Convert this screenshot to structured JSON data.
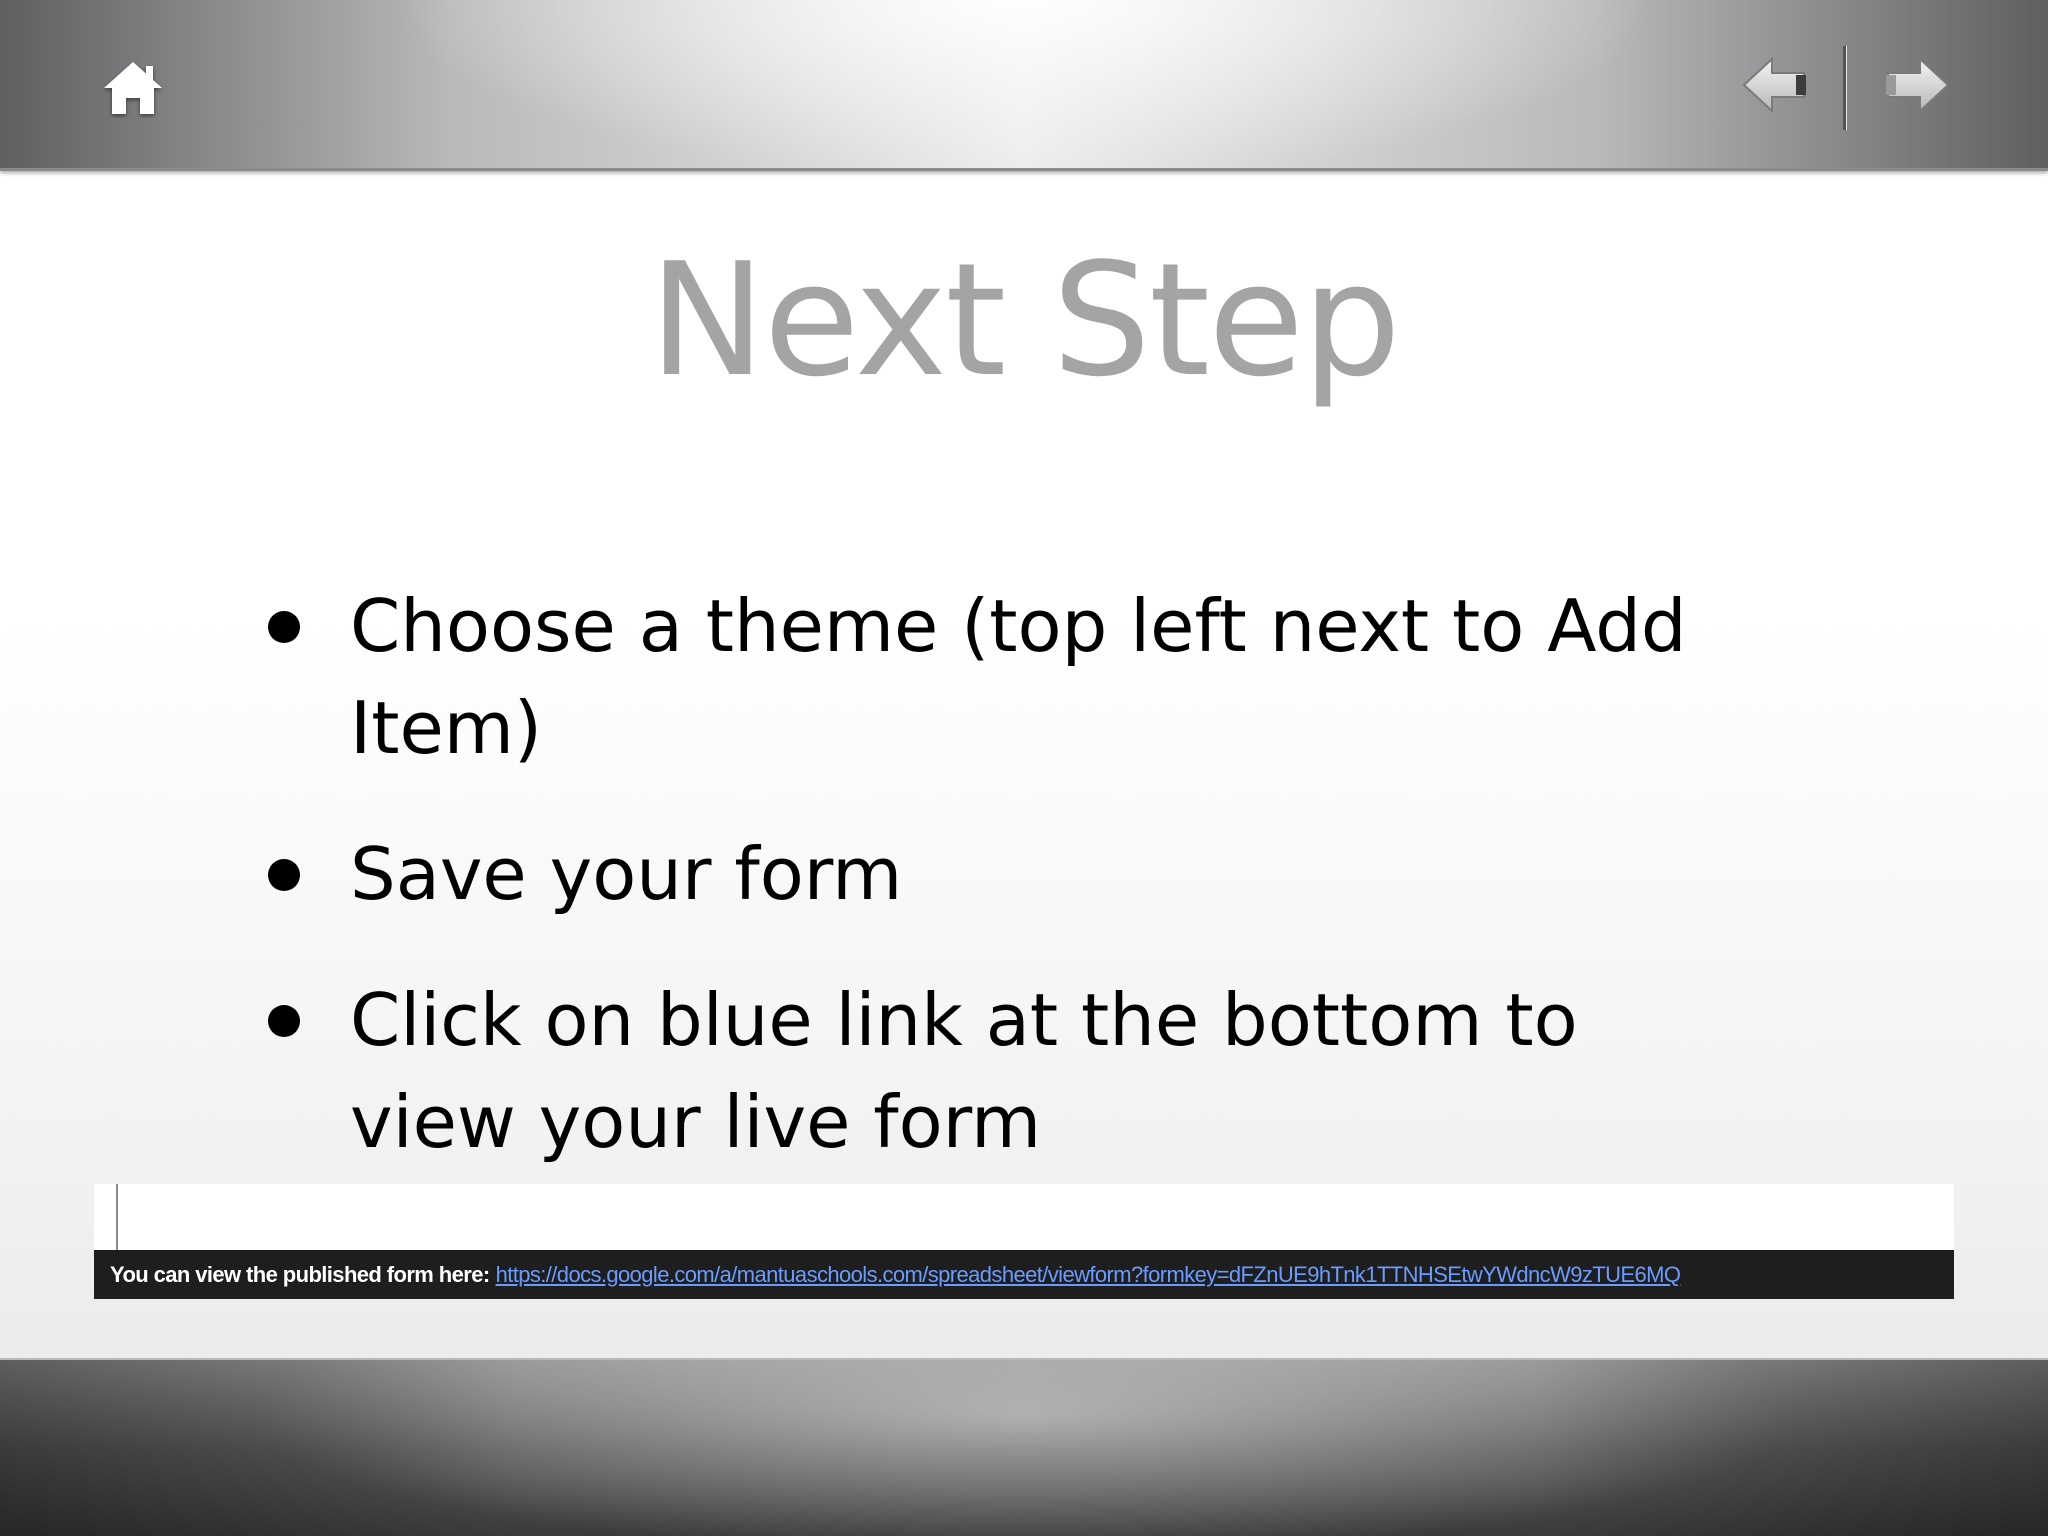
{
  "navigation": {
    "home_icon": "home-icon",
    "prev_icon": "arrow-left-icon",
    "next_icon": "arrow-right-icon"
  },
  "slide": {
    "title": "Next Step",
    "bullets": [
      "Choose a theme (top left next to Add Item)",
      "Save your form",
      "Click on blue link at the bottom to view your live form"
    ]
  },
  "embedded_screenshot": {
    "label": "You can view the published form here:",
    "link_text": "https://docs.google.com/a/mantuaschools.com/spreadsheet/viewform?formkey=dFZnUE9hTnk1TTNHSEtwYWdncW9zTUE6MQ"
  },
  "colors": {
    "title": "#a4a4a4",
    "link": "#6a9bff",
    "strip_background": "#1e1e1e"
  }
}
